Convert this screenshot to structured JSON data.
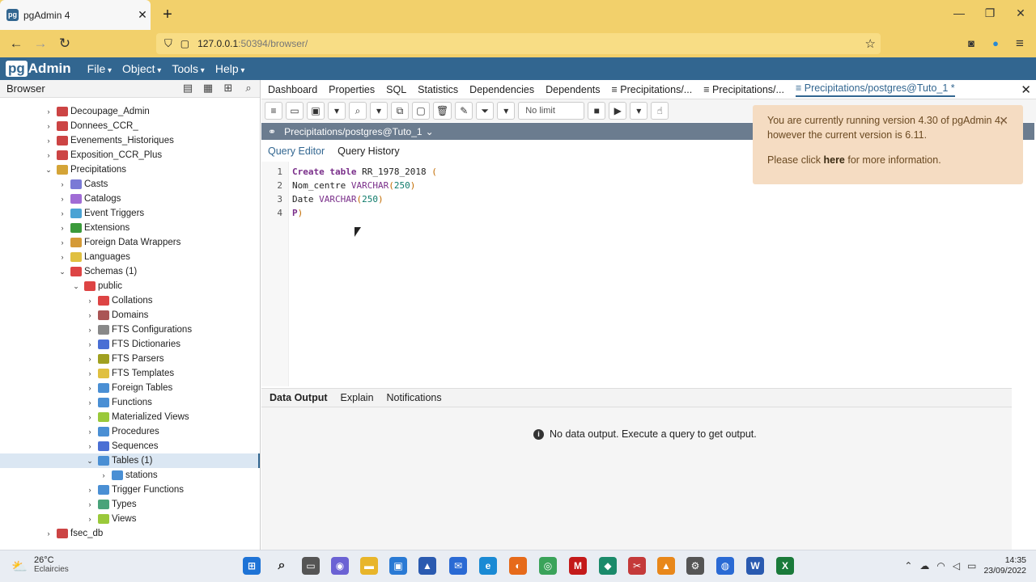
{
  "window": {
    "tab_title": "pgAdmin 4",
    "tab_close": "✕",
    "new_tab": "+",
    "minimize": "—",
    "maximize": "❐",
    "close": "✕"
  },
  "nav": {
    "url_host": "127.0.0.1",
    "url_rest": ":50394/browser/"
  },
  "app": {
    "logo_pg": "pg",
    "logo_rest": "Admin",
    "menus": [
      "File",
      "Object",
      "Tools",
      "Help"
    ]
  },
  "browser": {
    "title": "Browser",
    "tree": [
      {
        "label": "Decoupage_Admin",
        "level": 1,
        "expanded": false,
        "icon": "database-icon",
        "color": "#c44"
      },
      {
        "label": "Donnees_CCR_",
        "level": 1,
        "expanded": false,
        "icon": "database-icon",
        "color": "#c44"
      },
      {
        "label": "Evenements_Historiques",
        "level": 1,
        "expanded": false,
        "icon": "database-icon",
        "color": "#c44"
      },
      {
        "label": "Exposition_CCR_Plus",
        "level": 1,
        "expanded": false,
        "icon": "database-icon",
        "color": "#c44"
      },
      {
        "label": "Precipitations",
        "level": 1,
        "expanded": true,
        "icon": "database-icon",
        "color": "#d4a437"
      },
      {
        "label": "Casts",
        "level": 2,
        "expanded": false,
        "icon": "casts-icon",
        "color": "#7a7ad6"
      },
      {
        "label": "Catalogs",
        "level": 2,
        "expanded": false,
        "icon": "catalogs-icon",
        "color": "#a06cd5"
      },
      {
        "label": "Event Triggers",
        "level": 2,
        "expanded": false,
        "icon": "event-trigger-icon",
        "color": "#4aa3d4"
      },
      {
        "label": "Extensions",
        "level": 2,
        "expanded": false,
        "icon": "extensions-icon",
        "color": "#3a9a3a"
      },
      {
        "label": "Foreign Data Wrappers",
        "level": 2,
        "expanded": false,
        "icon": "fdw-icon",
        "color": "#d49a37"
      },
      {
        "label": "Languages",
        "level": 2,
        "expanded": false,
        "icon": "languages-icon",
        "color": "#e0c040"
      },
      {
        "label": "Schemas (1)",
        "level": 2,
        "expanded": true,
        "icon": "schemas-icon",
        "color": "#d44"
      },
      {
        "label": "public",
        "level": 3,
        "expanded": true,
        "icon": "schema-icon",
        "color": "#d44"
      },
      {
        "label": "Collations",
        "level": 4,
        "expanded": false,
        "icon": "collations-icon",
        "color": "#d44"
      },
      {
        "label": "Domains",
        "level": 4,
        "expanded": false,
        "icon": "domains-icon",
        "color": "#a55"
      },
      {
        "label": "FTS Configurations",
        "level": 4,
        "expanded": false,
        "icon": "fts-config-icon",
        "color": "#888"
      },
      {
        "label": "FTS Dictionaries",
        "level": 4,
        "expanded": false,
        "icon": "fts-dict-icon",
        "color": "#4a6fd4"
      },
      {
        "label": "FTS Parsers",
        "level": 4,
        "expanded": false,
        "icon": "fts-parser-icon",
        "color": "#a0a020"
      },
      {
        "label": "FTS Templates",
        "level": 4,
        "expanded": false,
        "icon": "fts-template-icon",
        "color": "#e0c040"
      },
      {
        "label": "Foreign Tables",
        "level": 4,
        "expanded": false,
        "icon": "foreign-table-icon",
        "color": "#4a8fd4"
      },
      {
        "label": "Functions",
        "level": 4,
        "expanded": false,
        "icon": "functions-icon",
        "color": "#4a8fd4"
      },
      {
        "label": "Materialized Views",
        "level": 4,
        "expanded": false,
        "icon": "mat-views-icon",
        "color": "#9ac93a"
      },
      {
        "label": "Procedures",
        "level": 4,
        "expanded": false,
        "icon": "procedures-icon",
        "color": "#4a8fd4"
      },
      {
        "label": "Sequences",
        "level": 4,
        "expanded": false,
        "icon": "sequences-icon",
        "color": "#4a6fd4"
      },
      {
        "label": "Tables (1)",
        "level": 4,
        "expanded": true,
        "icon": "tables-icon",
        "color": "#4a8fd4",
        "selected": true
      },
      {
        "label": "stations",
        "level": 5,
        "expanded": false,
        "icon": "table-icon",
        "color": "#4a8fd4"
      },
      {
        "label": "Trigger Functions",
        "level": 4,
        "expanded": false,
        "icon": "trigger-functions-icon",
        "color": "#4a8fd4"
      },
      {
        "label": "Types",
        "level": 4,
        "expanded": false,
        "icon": "types-icon",
        "color": "#4aa37a"
      },
      {
        "label": "Views",
        "level": 4,
        "expanded": false,
        "icon": "views-icon",
        "color": "#9ac93a"
      },
      {
        "label": "fsec_db",
        "level": 1,
        "expanded": false,
        "icon": "database-icon",
        "color": "#c44"
      }
    ]
  },
  "main_tabs": [
    "Dashboard",
    "Properties",
    "SQL",
    "Statistics",
    "Dependencies",
    "Dependents",
    "Precipitations/...",
    "Precipitations/...",
    "Precipitations/postgres@Tuto_1 *"
  ],
  "query_tool": {
    "limit": "No limit",
    "connection": "Precipitations/postgres@Tuto_1",
    "tabs": [
      "Query Editor",
      "Query History"
    ]
  },
  "editor": {
    "lines": [
      {
        "n": "1",
        "tokens": [
          [
            "kw",
            "Create "
          ],
          [
            "kw",
            "table "
          ],
          [
            "txt",
            "RR_1978_2018 "
          ],
          [
            "paren",
            "("
          ]
        ]
      },
      {
        "n": "2",
        "tokens": [
          [
            "txt",
            "Nom_centre "
          ],
          [
            "ty",
            "VARCHAR"
          ],
          [
            "paren",
            "("
          ],
          [
            "num",
            "250"
          ],
          [
            "paren",
            ")"
          ]
        ]
      },
      {
        "n": "3",
        "tokens": [
          [
            "txt",
            "Date "
          ],
          [
            "ty",
            "VARCHAR"
          ],
          [
            "paren",
            "("
          ],
          [
            "num",
            "250"
          ],
          [
            "paren",
            ")"
          ]
        ]
      },
      {
        "n": "4",
        "tokens": [
          [
            "kw",
            "P"
          ],
          [
            "paren",
            ")"
          ]
        ]
      }
    ]
  },
  "output": {
    "tabs": [
      "Data Output",
      "Explain",
      "Notifications"
    ],
    "message": "No data output. Execute a query to get output."
  },
  "notice": {
    "line1": "You are currently running version 4.30 of pgAdmin 4,",
    "line2": "however the current version is 6.11.",
    "p2_prefix": "Please click ",
    "p2_link": "here",
    "p2_suffix": " for more information."
  },
  "taskbar": {
    "temp": "26°C",
    "weather": "Eclaircies",
    "time": "14:35",
    "date": "23/09/2022"
  }
}
